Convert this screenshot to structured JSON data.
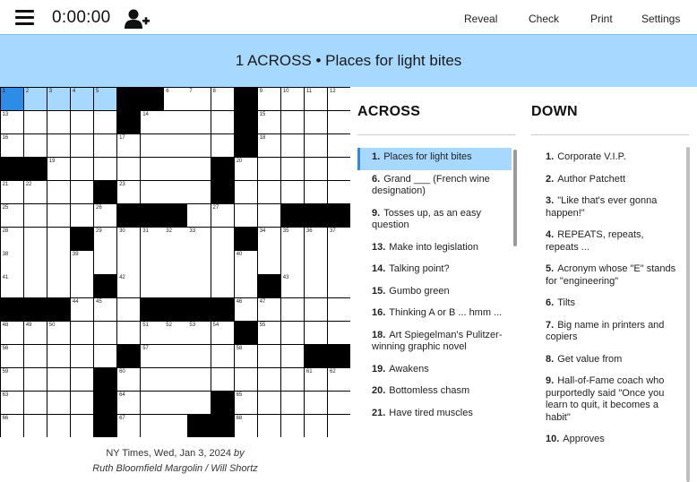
{
  "header": {
    "timer": "0:00:00",
    "menu": {
      "reveal": "Reveal",
      "check": "Check",
      "print": "Print",
      "settings": "Settings"
    }
  },
  "current_clue": "1 ACROSS • Places for light bites",
  "colors": {
    "highlight": "#a7d8ff",
    "selected": "#2f8ce6",
    "block": "#000000"
  },
  "grid": {
    "rows": [
      "#####..####.####",
      "1.......",
      "1.......",
      "1.......",
      "1.......",
      "1.......",
      "1.......",
      "1.......",
      "1.......",
      "1.......",
      "1.......",
      "1.......",
      "1.......",
      "1.......",
      "1.......",
      "1......."
    ],
    "pattern": [
      ".....##...#.....",
      ".....#....#.....",
      ".....#....#.....",
      "##......#.......",
      "....#.......#...",
      "....#.....#.....",
      "...#......#.....",
      "...............",
      "...............",
      "....#.......#...",
      "...#........#...",
      ".....#......#...",
      "............##.",
      "....#........#..",
      "....#....#......",
      "....#...##......"
    ],
    "numbers": [
      [
        1,
        2,
        3,
        4,
        5,
        0,
        0,
        6,
        7,
        8,
        0,
        9,
        10,
        11,
        12
      ],
      [
        13,
        0,
        0,
        0,
        0,
        0,
        14,
        0,
        0,
        0,
        0,
        15,
        0,
        0,
        0
      ],
      [
        16,
        0,
        0,
        0,
        0,
        17,
        0,
        0,
        0,
        0,
        0,
        18,
        0,
        0,
        0
      ],
      [
        0,
        0,
        19,
        0,
        0,
        0,
        0,
        0,
        0,
        0,
        20,
        0,
        0,
        0,
        0
      ],
      [
        21,
        22,
        0,
        0,
        0,
        23,
        0,
        0,
        0,
        24,
        0,
        0,
        0,
        0,
        0
      ],
      [
        25,
        0,
        0,
        0,
        26,
        0,
        0,
        0,
        0,
        27,
        0,
        0,
        0,
        0,
        0
      ],
      [
        28,
        0,
        0,
        0,
        29,
        30,
        31,
        32,
        33,
        0,
        0,
        34,
        35,
        36,
        37
      ],
      [
        38,
        0,
        0,
        39,
        0,
        0,
        0,
        0,
        0,
        0,
        40,
        0,
        0,
        0,
        0
      ],
      [
        41,
        0,
        0,
        0,
        0,
        42,
        0,
        0,
        0,
        0,
        0,
        0,
        43,
        0,
        0
      ],
      [
        0,
        0,
        0,
        44,
        45,
        0,
        0,
        0,
        0,
        0,
        46,
        47,
        0,
        0,
        0
      ],
      [
        48,
        49,
        50,
        0,
        0,
        0,
        51,
        52,
        53,
        54,
        0,
        55,
        0,
        0,
        0
      ],
      [
        56,
        0,
        0,
        0,
        0,
        0,
        57,
        0,
        0,
        0,
        58,
        0,
        0,
        0,
        0
      ],
      [
        59,
        0,
        0,
        0,
        0,
        60,
        0,
        0,
        0,
        0,
        0,
        0,
        0,
        61,
        62
      ],
      [
        63,
        0,
        0,
        0,
        0,
        64,
        0,
        0,
        0,
        0,
        65,
        0,
        0,
        0,
        0
      ],
      [
        66,
        0,
        0,
        0,
        0,
        67,
        0,
        0,
        0,
        0,
        68,
        0,
        0,
        0,
        0
      ]
    ],
    "blocks": [
      [
        0,
        5
      ],
      [
        0,
        6
      ],
      [
        0,
        10
      ],
      [
        1,
        5
      ],
      [
        1,
        10
      ],
      [
        2,
        10
      ],
      [
        3,
        0
      ],
      [
        3,
        1
      ],
      [
        3,
        9
      ],
      [
        4,
        4
      ],
      [
        4,
        9
      ],
      [
        5,
        5
      ],
      [
        5,
        6
      ],
      [
        5,
        7
      ],
      [
        5,
        12
      ],
      [
        5,
        13
      ],
      [
        5,
        14
      ],
      [
        6,
        3
      ],
      [
        6,
        10
      ],
      [
        8,
        4
      ],
      [
        8,
        11
      ],
      [
        9,
        0
      ],
      [
        9,
        1
      ],
      [
        9,
        2
      ],
      [
        9,
        6
      ],
      [
        9,
        7
      ],
      [
        9,
        8
      ],
      [
        9,
        9
      ],
      [
        10,
        10
      ],
      [
        11,
        5
      ],
      [
        11,
        13
      ],
      [
        11,
        14
      ],
      [
        12,
        4
      ],
      [
        13,
        4
      ],
      [
        13,
        9
      ],
      [
        14,
        4
      ],
      [
        14,
        8
      ],
      [
        14,
        9
      ]
    ],
    "selected": [
      0,
      0
    ],
    "highlighted": [
      [
        0,
        1
      ],
      [
        0,
        2
      ],
      [
        0,
        3
      ],
      [
        0,
        4
      ]
    ]
  },
  "puzzle_info": {
    "source": "NY Times, Wed, Jan 3, 2024",
    "by": "by",
    "authors": "Ruth Bloomfield Margolin / Will Shortz"
  },
  "across": {
    "title": "ACROSS",
    "clues": [
      {
        "num": "1.",
        "text": "Places for light bites",
        "active": true
      },
      {
        "num": "6.",
        "text": "Grand ___ (French wine designation)"
      },
      {
        "num": "9.",
        "text": "Tosses up, as an easy question"
      },
      {
        "num": "13.",
        "text": "Make into legislation"
      },
      {
        "num": "14.",
        "text": "Talking point?"
      },
      {
        "num": "15.",
        "text": "Gumbo green"
      },
      {
        "num": "16.",
        "text": "Thinking A or B ... hmm ..."
      },
      {
        "num": "18.",
        "text": "Art Spiegelman's Pulitzer-winning graphic novel"
      },
      {
        "num": "19.",
        "text": "Awakens"
      },
      {
        "num": "20.",
        "text": "Bottomless chasm"
      },
      {
        "num": "21.",
        "text": "Have tired muscles"
      }
    ]
  },
  "down": {
    "title": "DOWN",
    "clues": [
      {
        "num": "1.",
        "text": "Corporate V.I.P."
      },
      {
        "num": "2.",
        "text": "Author Patchett"
      },
      {
        "num": "3.",
        "text": "\"Like that's ever gonna happen!\""
      },
      {
        "num": "4.",
        "text": "REPEATS, repeats, repeats ..."
      },
      {
        "num": "5.",
        "text": "Acronym whose \"E\" stands for \"engineering\""
      },
      {
        "num": "6.",
        "text": "Tilts"
      },
      {
        "num": "7.",
        "text": "Big name in printers and copiers"
      },
      {
        "num": "8.",
        "text": "Get value from"
      },
      {
        "num": "9.",
        "text": "Hall-of-Fame coach who purportedly said \"Once you learn to quit, it becomes a habit\""
      },
      {
        "num": "10.",
        "text": "Approves"
      }
    ]
  }
}
